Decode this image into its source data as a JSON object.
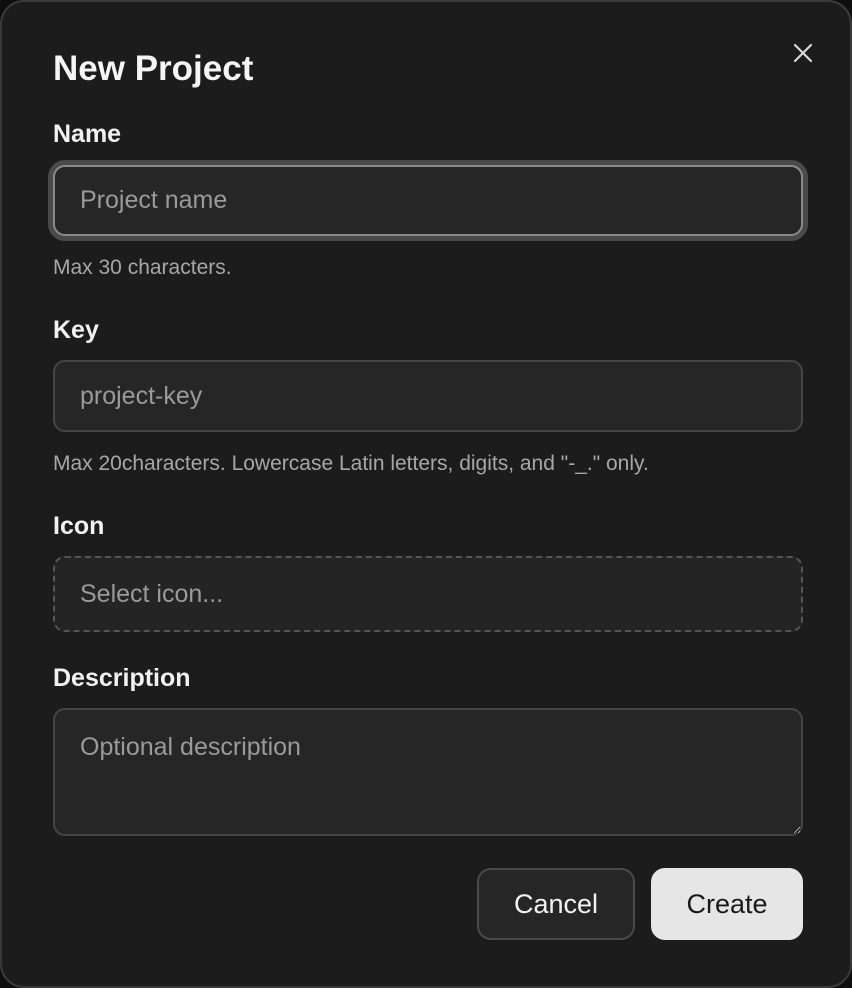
{
  "dialog": {
    "title": "New Project",
    "close_icon": "close-icon"
  },
  "name_field": {
    "label": "Name",
    "placeholder": "Project name",
    "value": "",
    "hint": "Max 30 characters."
  },
  "key_field": {
    "label": "Key",
    "placeholder": "project-key",
    "value": "",
    "hint": "Max 20characters. Lowercase Latin letters, digits, and \"-_.\" only."
  },
  "icon_field": {
    "label": "Icon",
    "placeholder": "Select icon..."
  },
  "description_field": {
    "label": "Description",
    "placeholder": "Optional description",
    "value": ""
  },
  "actions": {
    "cancel_label": "Cancel",
    "create_label": "Create"
  },
  "colors": {
    "background": "#1c1c1c",
    "primary_button": "#e6e6e6",
    "border": "#454545"
  }
}
